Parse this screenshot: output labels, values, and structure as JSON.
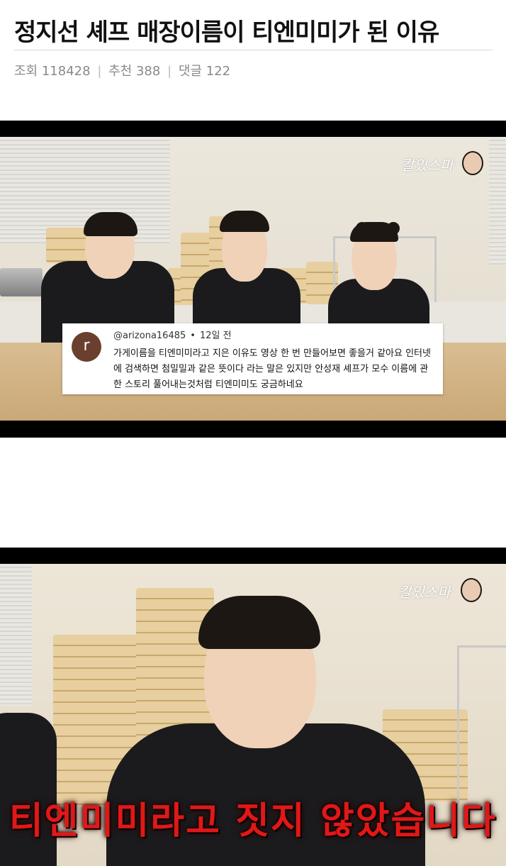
{
  "post": {
    "title": "정지선 셰프 매장이름이 티엔미미가 된 이유",
    "meta": {
      "views_label": "조회",
      "views": "118428",
      "recommend_label": "추천",
      "recommend": "388",
      "comments_label": "댓글",
      "comments": "122",
      "separator": "|"
    }
  },
  "frames": [
    {
      "channel_logo": "칼있스마",
      "comment": {
        "avatar_letter": "r",
        "username": "@arizona16485",
        "dot": "•",
        "time": "12일 전",
        "lines": [
          "가게이름을 티엔미미라고 지은 이유도 영상 한 번 만들어보면 좋을거 같아요 인터넷",
          "에 검색하면 첨밀밀과 같은 뜻이다 라는 말은 있지만 안성재 셰프가 모수 이름에 관",
          "한 스토리 풀어내는것처럼 티엔미미도 궁금하네요"
        ]
      }
    },
    {
      "channel_logo": "칼있스마",
      "caption": "티엔미미라고 짓지 않았습니다"
    }
  ],
  "colors": {
    "caption": "#e01818",
    "avatar_bg": "#6b3f2d",
    "letterbox": "#000000"
  }
}
